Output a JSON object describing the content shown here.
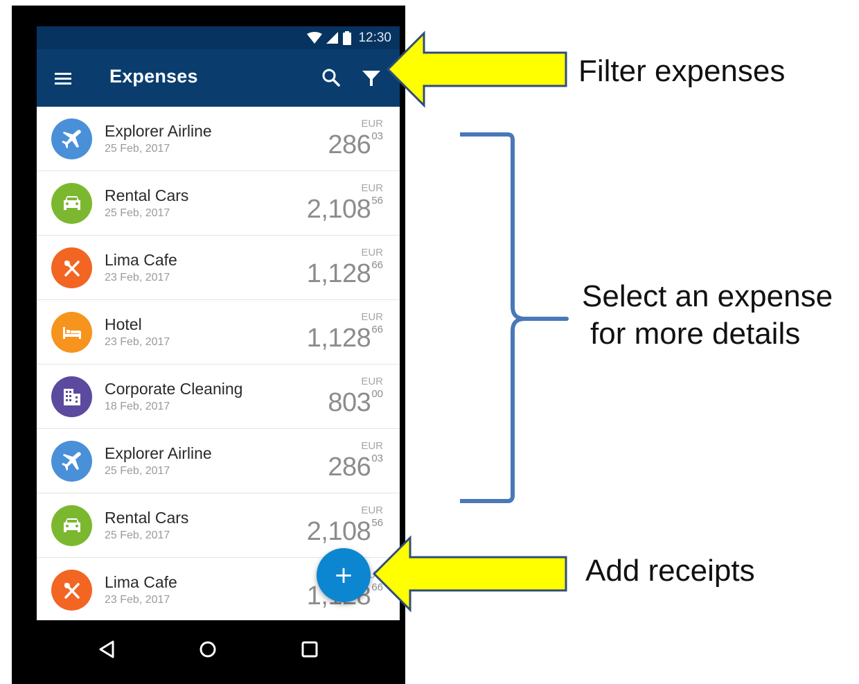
{
  "status_bar": {
    "time": "12:30"
  },
  "app_bar": {
    "title": "Expenses"
  },
  "expenses": [
    {
      "name": "Explorer Airline",
      "date": "25 Feb, 2017",
      "currency": "EUR",
      "major": "286",
      "minor": "03",
      "icon": "airplane-icon",
      "color": "#4a90d9"
    },
    {
      "name": "Rental Cars",
      "date": "25 Feb, 2017",
      "currency": "EUR",
      "major": "2,108",
      "minor": "56",
      "icon": "car-icon",
      "color": "#7cb82f"
    },
    {
      "name": "Lima Cafe",
      "date": "23 Feb, 2017",
      "currency": "EUR",
      "major": "1,128",
      "minor": "66",
      "icon": "restaurant-icon",
      "color": "#f26522"
    },
    {
      "name": "Hotel",
      "date": "23 Feb, 2017",
      "currency": "EUR",
      "major": "1,128",
      "minor": "66",
      "icon": "bed-icon",
      "color": "#f7941d"
    },
    {
      "name": "Corporate Cleaning",
      "date": "18 Feb, 2017",
      "currency": "EUR",
      "major": "803",
      "minor": "00",
      "icon": "building-icon",
      "color": "#5b4a9e"
    },
    {
      "name": "Explorer Airline",
      "date": "25 Feb, 2017",
      "currency": "EUR",
      "major": "286",
      "minor": "03",
      "icon": "airplane-icon",
      "color": "#4a90d9"
    },
    {
      "name": "Rental Cars",
      "date": "25 Feb, 2017",
      "currency": "EUR",
      "major": "2,108",
      "minor": "56",
      "icon": "car-icon",
      "color": "#7cb82f"
    },
    {
      "name": "Lima Cafe",
      "date": "23 Feb, 2017",
      "currency": "EUR",
      "major": "1,128",
      "minor": "66",
      "icon": "restaurant-icon",
      "color": "#f26522"
    }
  ],
  "fab": {
    "label": "+"
  },
  "annotations": {
    "filter": "Filter expenses",
    "select_line1": "Select an expense",
    "select_line2": "for more details",
    "add": "Add receipts"
  },
  "colors": {
    "app_bar": "#0a3d6e",
    "status_bar": "#06335f",
    "fab": "#0d86d1",
    "arrow_fill": "#ffff00",
    "arrow_stroke": "#2e4d7a",
    "bracket": "#4a78b8"
  }
}
